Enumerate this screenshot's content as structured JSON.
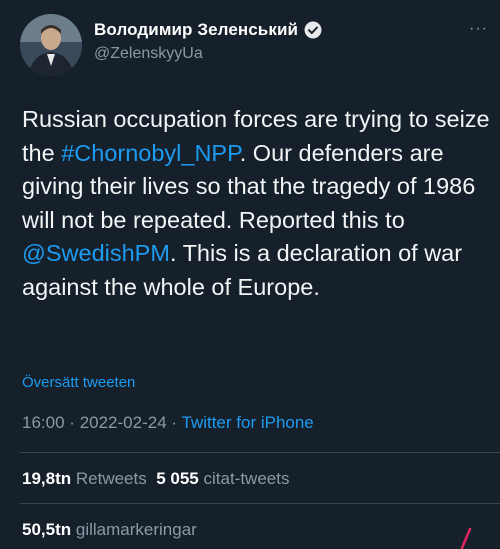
{
  "author": {
    "display_name": "Володимир Зеленський",
    "handle": "@ZelenskyyUa",
    "verified": true,
    "more_label": "···"
  },
  "tweet": {
    "part1": "Russian occupation forces are trying to seize the ",
    "hashtag": "#Chornobyl_NPP",
    "part2": ". Our defenders are giving their lives so that the tragedy of 1986 will not be repeated. Reported this to ",
    "mention": "@SwedishPM",
    "part3": ". This is a declaration of war against the whole of Europe."
  },
  "translate_label": "Översätt tweeten",
  "meta": {
    "time": "16:00",
    "date": "2022-02-24",
    "source": "Twitter for iPhone",
    "separator": "·"
  },
  "stats": {
    "retweets_count": "19,8tn",
    "retweets_label": "Retweets",
    "quotes_count": "5 055",
    "quotes_label": "citat-tweets",
    "likes_count": "50,5tn",
    "likes_label": "gillamarkeringar"
  },
  "colors": {
    "background": "#15202b",
    "link": "#1d9bf0",
    "muted": "#8b98a5",
    "divider": "#38444d"
  }
}
